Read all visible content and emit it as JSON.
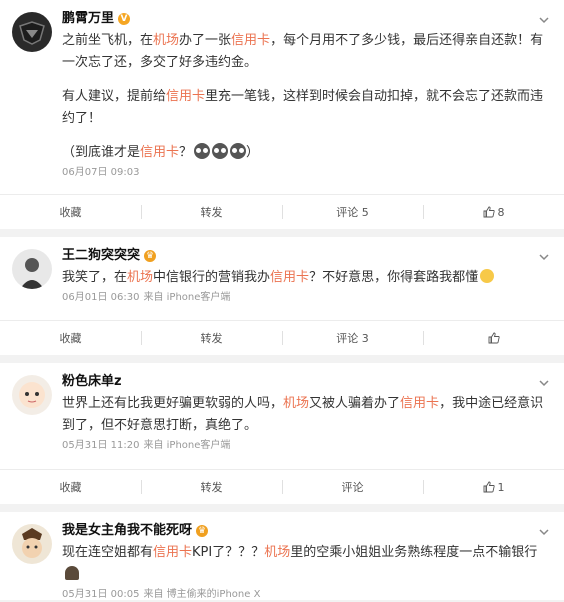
{
  "posts": [
    {
      "author": "鹏霄万里",
      "lines": [
        [
          "之前坐飞机，在",
          {
            "hl": "机场"
          },
          "办了一张",
          {
            "hl": "信用卡"
          },
          "，每个月用不了多少钱，最后还得亲自还款！有一次忘了还，多交了好多违约金。"
        ],
        "GAP",
        [
          "有人建议，提前给",
          {
            "hl": "信用卡"
          },
          "里充一笔钱，这样到时候会自动扣掉，就不会忘了还款而违约了！"
        ],
        "GAP",
        [
          "（到底谁才是",
          {
            "hl": "信用卡"
          },
          "？"
        ]
      ],
      "time": "06月07日 09:03",
      "source": "",
      "actions": {
        "collect": "收藏",
        "repost": "转发",
        "comment": "评论 5",
        "like": "8"
      }
    },
    {
      "author": "王二狗突突突",
      "lines": [
        [
          "我笑了，在",
          {
            "hl": "机场"
          },
          "中信银行的营销我办",
          {
            "hl": "信用卡"
          },
          "？不好意思，你得套路我都懂"
        ]
      ],
      "time": "06月01日 06:30",
      "source": "来自 iPhone客户端",
      "actions": {
        "collect": "收藏",
        "repost": "转发",
        "comment": "评论 3",
        "like": ""
      }
    },
    {
      "author": "粉色床单z",
      "lines": [
        [
          "世界上还有比我更好骗更软弱的人吗，",
          {
            "hl": "机场"
          },
          "又被人骗着办了",
          {
            "hl": "信用卡"
          },
          "，我中途已经意识到了，但不好意思打断，真绝了。"
        ]
      ],
      "time": "05月31日 11:20",
      "source": "来自 iPhone客户端",
      "actions": {
        "collect": "收藏",
        "repost": "转发",
        "comment": "评论",
        "like": "1"
      }
    },
    {
      "author": "我是女主角我不能死呀",
      "lines": [
        [
          "现在连空姐都有",
          {
            "hl": "信用卡"
          },
          "KPI了？？？",
          {
            "hl": "机场"
          },
          "里的空乘小姐姐业务熟练程度一点不输银行"
        ]
      ],
      "time": "05月31日 00:05",
      "source": "来自 博主偷来的iPhone X",
      "actions": null
    }
  ],
  "colors": {
    "highlight": "#eb7350",
    "text": "#333333",
    "meta": "#999999"
  }
}
